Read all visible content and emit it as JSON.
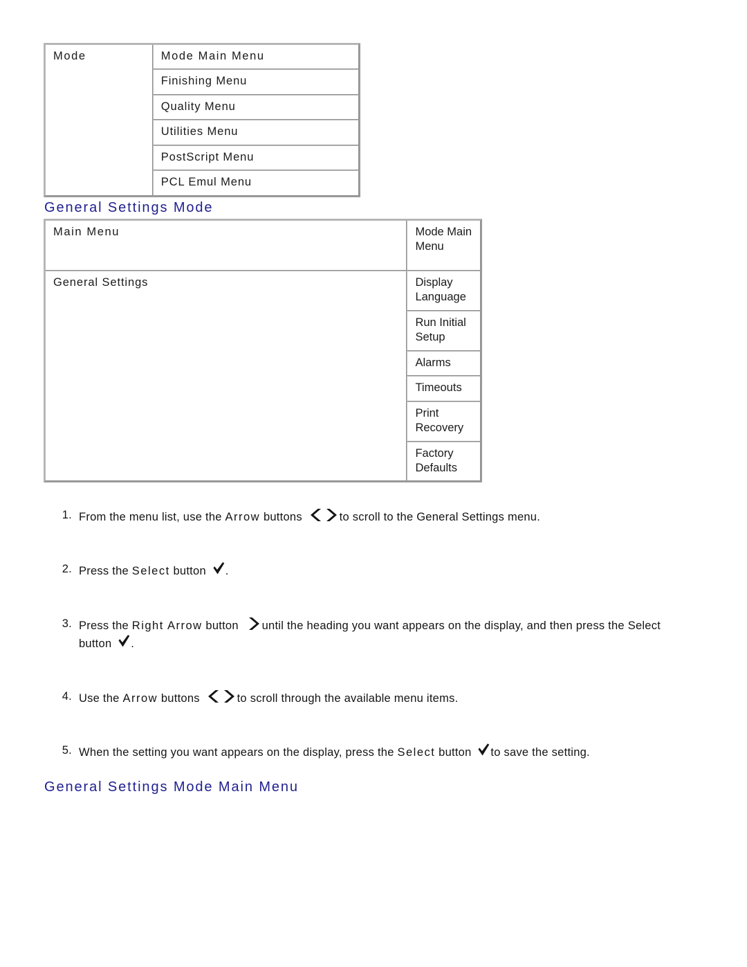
{
  "document": {
    "title": "General Settings Mode"
  },
  "mode_table": {
    "label": "Mode",
    "rows": [
      "Mode Main Menu",
      "Finishing Menu",
      "Quality Menu",
      "Utilities Menu",
      "PostScript Menu",
      "PCL Emul Menu"
    ]
  },
  "headings": {
    "general_settings_mode": "General Settings Mode",
    "general_settings_mode_main_menu": "General Settings Mode Main Menu"
  },
  "general_settings_table": {
    "rows": [
      {
        "left": "Main Menu",
        "right": [
          "Mode Main Menu"
        ]
      },
      {
        "left": "General Settings",
        "right": [
          "Display Language",
          "Run Initial Setup",
          "Alarms",
          "Timeouts",
          "Print Recovery",
          "Factory Defaults"
        ]
      }
    ]
  },
  "steps": [
    {
      "number": "1.",
      "part_a": "From the menu list, use the ",
      "emphasis": "Arrow",
      "part_b": " buttons ",
      "icon": "arrows-left-right-icon",
      "part_c": "to scroll to the General Settings menu.",
      "part_d": "",
      "icon2": "",
      "part_e": ""
    },
    {
      "number": "2.",
      "part_a": "Press the ",
      "emphasis": "Select",
      "part_b": " button ",
      "icon": "checkmark-icon",
      "part_c": ".",
      "part_d": "",
      "icon2": "",
      "part_e": ""
    },
    {
      "number": "3.",
      "part_a": "Press the ",
      "emphasis": "Right Arrow",
      "part_b": " button ",
      "icon": "arrow-right-icon",
      "part_c": "until the heading you want appears on the display, and then press the ",
      "part_d": "Select button ",
      "icon2": "checkmark-icon",
      "part_e": "."
    },
    {
      "number": "4.",
      "part_a": "Use the ",
      "emphasis": "Arrow",
      "part_b": " buttons ",
      "icon": "arrows-left-right-icon",
      "part_c": "to scroll through the available menu items.",
      "part_d": "",
      "icon2": "",
      "part_e": ""
    },
    {
      "number": "5.",
      "part_a": "When the setting you want appears on the display, press the ",
      "emphasis": "Select",
      "part_b": " button ",
      "icon": "checkmark-icon",
      "part_c": "to save the setting.",
      "part_d": "",
      "icon2": "",
      "part_e": ""
    }
  ],
  "colors": {
    "heading": "#1f1f8f",
    "text": "#141414",
    "table_border": "#a8a8a8",
    "page_background": "#ffffff"
  }
}
